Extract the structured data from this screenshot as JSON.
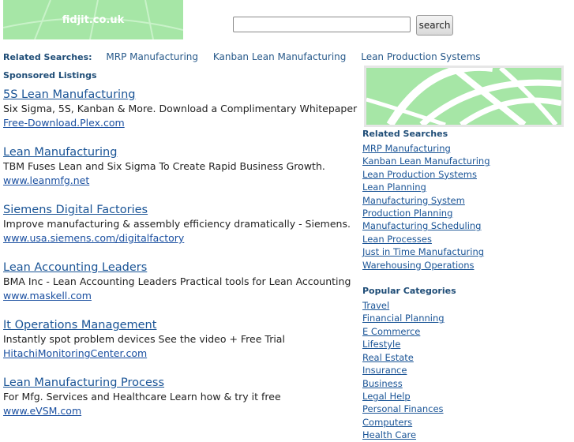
{
  "logo": {
    "text": "fidjit.co.uk"
  },
  "search": {
    "value": "",
    "button_label": "search"
  },
  "related_bar": {
    "label": "Related Searches:",
    "links": [
      "MRP Manufacturing",
      "Kanban Lean Manufacturing",
      "Lean Production Systems"
    ]
  },
  "sponsored": {
    "label": "Sponsored Listings",
    "listings": [
      {
        "title": "5S Lean Manufacturing",
        "desc": "Six Sigma, 5S, Kanban & More. Download a Complimentary Whitepaper",
        "url": "Free-Download.Plex.com"
      },
      {
        "title": "Lean Manufacturing",
        "desc": "TBM Fuses Lean and Six Sigma To Create Rapid Business Growth.",
        "url": "www.leanmfg.net"
      },
      {
        "title": "Siemens Digital Factories",
        "desc": "Improve manufacturing & assembly efficiency dramatically - Siemens.",
        "url": "www.usa.siemens.com/digitalfactory"
      },
      {
        "title": "Lean Accounting Leaders",
        "desc": "BMA Inc - Lean Accounting Leaders Practical tools for Lean Accounting",
        "url": "www.maskell.com"
      },
      {
        "title": "It Operations Management",
        "desc": "Instantly spot problem devices See the video + Free Trial",
        "url": "HitachiMonitoringCenter.com"
      },
      {
        "title": "Lean Manufacturing Process",
        "desc": "For Mfg. Services and Healthcare Learn how & try it free",
        "url": "www.eVSM.com"
      }
    ]
  },
  "sidebar": {
    "related_heading": "Related Searches",
    "related_links": [
      "MRP Manufacturing",
      "Kanban Lean Manufacturing",
      "Lean Production Systems",
      "Lean Planning",
      "Manufacturing System",
      "Production Planning",
      "Manufacturing Scheduling",
      "Lean Processes",
      "Just in Time Manufacturing",
      "Warehousing Operations"
    ],
    "popular_heading": "Popular Categories",
    "popular_links": [
      "Travel",
      "Financial Planning",
      "E Commerce",
      "Lifestyle",
      "Real Estate",
      "Insurance",
      "Business",
      "Legal Help",
      "Personal Finances",
      "Computers",
      "Health Care"
    ]
  },
  "colors": {
    "logo_bg": "#a6e6a6",
    "link": "#1a5496",
    "heading": "#1f4d77"
  }
}
